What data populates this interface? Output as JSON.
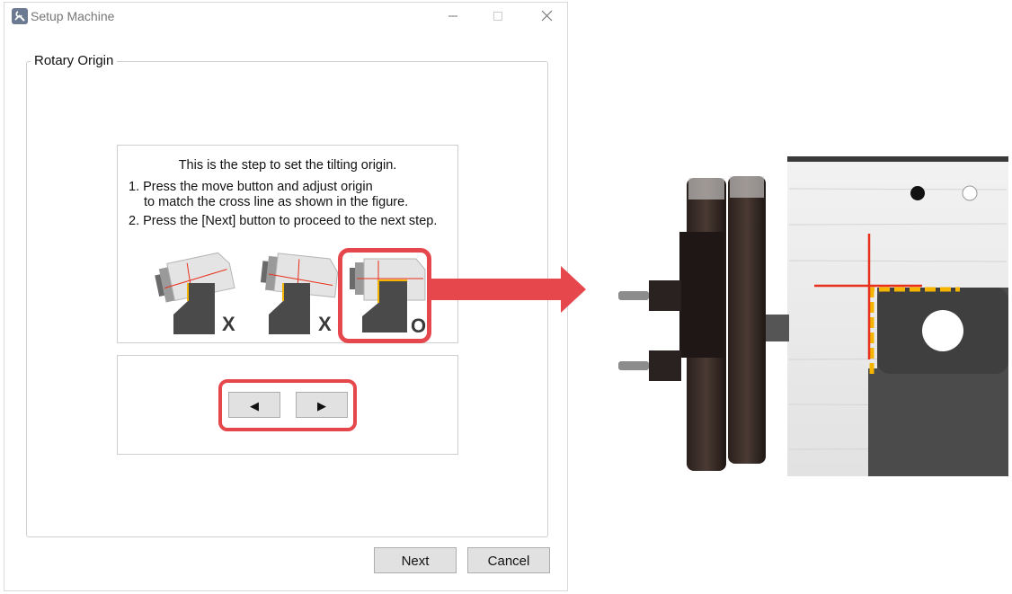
{
  "window": {
    "title": "Setup Machine",
    "app_icon": "setup-tools-icon",
    "controls": [
      "minimize-icon",
      "maximize-icon",
      "close-icon"
    ]
  },
  "group": {
    "legend": "Rotary Origin"
  },
  "instructions": {
    "title": "This is the step to set the tilting origin.",
    "step1_line1": "1. Press the move button and adjust origin",
    "step1_line2": "to match the cross line as shown in the figure.",
    "step2": "2. Press the [Next] button to proceed to the next step."
  },
  "figure": {
    "labels": [
      "X",
      "X",
      "O"
    ],
    "highlight_color": "#e5474d",
    "cross_line_color": "#e8301c",
    "origin_marker_color": "#f5b400"
  },
  "nav": {
    "prev_label": "◀",
    "next_label": "▶"
  },
  "buttons": {
    "next": "Next",
    "cancel": "Cancel"
  }
}
